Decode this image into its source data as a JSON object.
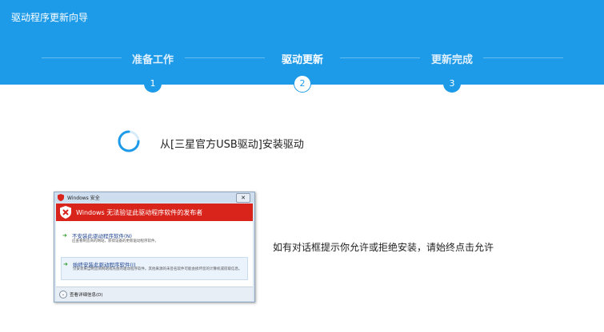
{
  "window": {
    "title": "驱动程序更新向导"
  },
  "steps": [
    {
      "label": "准备工作",
      "number": "1",
      "active": false
    },
    {
      "label": "驱动更新",
      "number": "2",
      "active": true
    },
    {
      "label": "更新完成",
      "number": "3",
      "active": false
    }
  ],
  "status": {
    "text": "从[三星官方USB驱动]安装驱动"
  },
  "dialog": {
    "title": "Windows 安全",
    "close_label": "✕",
    "banner": "Windows 无法验证此驱动程序软件的发布者",
    "options": [
      {
        "title": "不安装此驱动程序软件(N)",
        "desc": "应查看制造商的网站，获得设备的更新驱动程序软件。"
      },
      {
        "title": "始终安装此驱动程序软件(I)",
        "desc": "仅安装来自制造商网站或光盘的驱动程序软件。其他来源的未签名软件可能会损坏您的计算机或窃取信息。"
      }
    ],
    "details_label": "查看详细信息(D)"
  },
  "hint": {
    "text": "如有对话框提示你允许或拒绝安装，请始终点击允许"
  },
  "colors": {
    "header": "#1e9be8",
    "banner": "#d9241c",
    "accent_arrow": "#2a9a2a"
  },
  "icons": [
    "spinner-icon",
    "shield-warning-icon",
    "close-icon",
    "arrow-right-icon",
    "chevron-down-icon"
  ]
}
